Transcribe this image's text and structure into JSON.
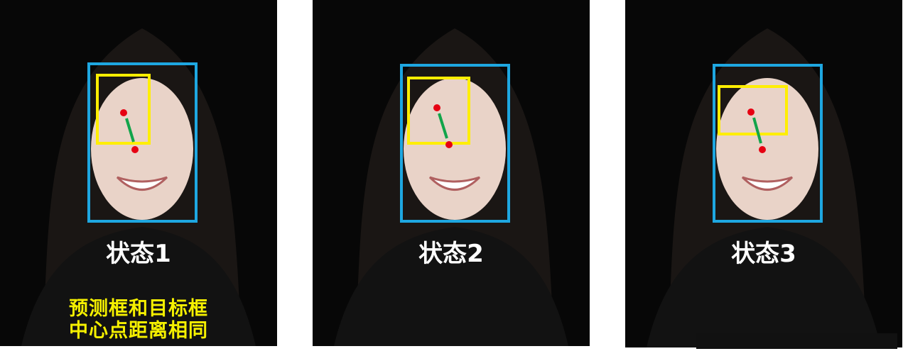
{
  "colors": {
    "target_box": "#1ea7e1",
    "predicted_box": "#ffee00",
    "center_point": "#e60012",
    "distance_arrow": "#12a44a"
  },
  "panels": [
    {
      "label": "状态1",
      "note_lines": [
        "预测框和目标框",
        "中心点距离相同"
      ]
    },
    {
      "label": "状态2"
    },
    {
      "label": "状态3"
    }
  ]
}
